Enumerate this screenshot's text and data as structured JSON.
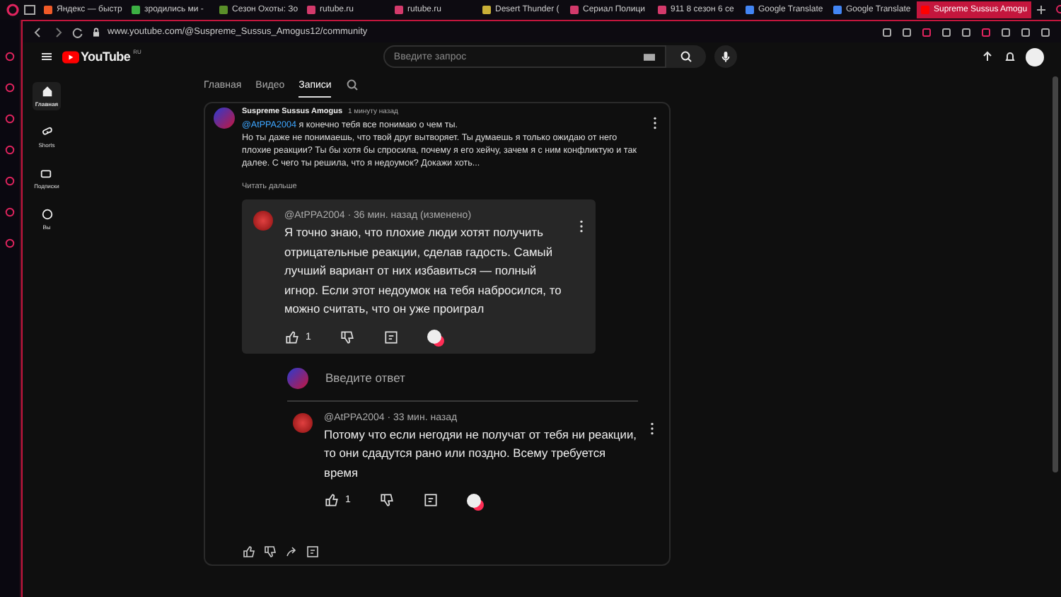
{
  "browser": {
    "tabs": [
      {
        "title": "Яндекс — быстр",
        "selected": false,
        "color": "#f05a28"
      },
      {
        "title": "зродились ми -",
        "selected": false,
        "color": "#3cb043"
      },
      {
        "title": "Сезон Охоты: Зо",
        "selected": false,
        "color": "#5a8f29"
      },
      {
        "title": "rutube.ru",
        "selected": false,
        "color": "#d33a6b"
      },
      {
        "title": "rutube.ru",
        "selected": false,
        "color": "#d33a6b"
      },
      {
        "title": "Desert Thunder (",
        "selected": false,
        "color": "#c9b037"
      },
      {
        "title": "Сериал Полици",
        "selected": false,
        "color": "#d33a6b"
      },
      {
        "title": "911 8 сезон 6 се",
        "selected": false,
        "color": "#d33a6b"
      },
      {
        "title": "Google Translate",
        "selected": false,
        "color": "#4285f4"
      },
      {
        "title": "Google Translate",
        "selected": false,
        "color": "#4285f4"
      },
      {
        "title": "Supreme Sussus Amogu",
        "selected": true,
        "color": "#ff0000"
      }
    ],
    "address": "www.youtube.com/@Suspreme_Sussus_Amogus12/community"
  },
  "youtube": {
    "logo": "YouTube",
    "region": "RU",
    "search_placeholder": "Введите запрос",
    "sidebar": [
      {
        "label": "Главная",
        "selected": true
      },
      {
        "label": "Shorts",
        "selected": false
      },
      {
        "label": "Подписки",
        "selected": false
      },
      {
        "label": "Вы",
        "selected": false
      }
    ],
    "channel_tabs": [
      {
        "label": "Главная",
        "selected": false
      },
      {
        "label": "Видео",
        "selected": false
      },
      {
        "label": "Записи",
        "selected": true
      }
    ],
    "post": {
      "author": "Suspreme Sussus Amogus",
      "time": "1 минуту назад",
      "mention": "@AtPPA2004",
      "first_line": "я конечно тебя все понимаю о чем ты.",
      "rest": "Но ты даже не понимаешь, что твой друг вытворяет. Ты думаешь я только ожидаю от него плохие реакции? Ты бы хотя бы спросила, почему я его хейчу, зачем я с ним конфликтую и так далее. С чего ты решила, что я недоумок? Докажи хоть...",
      "read_more": "Читать дальше"
    },
    "replies": [
      {
        "header": "@AtPPA2004 · 36 мин. назад (изменено)",
        "text": "Я точно знаю, что плохие люди хотят получить отрицательные реакции, сделав гадость. Самый лучший вариант от них избавиться — полный игнор. Если этот недоумок на тебя набросился, то можно считать, что он уже проиграл",
        "likes": "1",
        "highlighted": true
      },
      {
        "header": "@AtPPA2004 · 33 мин. назад",
        "text": "Потому что если негодяи не получат от тебя ни реакции, то они сдадутся рано или поздно. Всему требуется время",
        "likes": "1",
        "highlighted": false
      }
    ],
    "reply_placeholder": "Введите ответ"
  }
}
